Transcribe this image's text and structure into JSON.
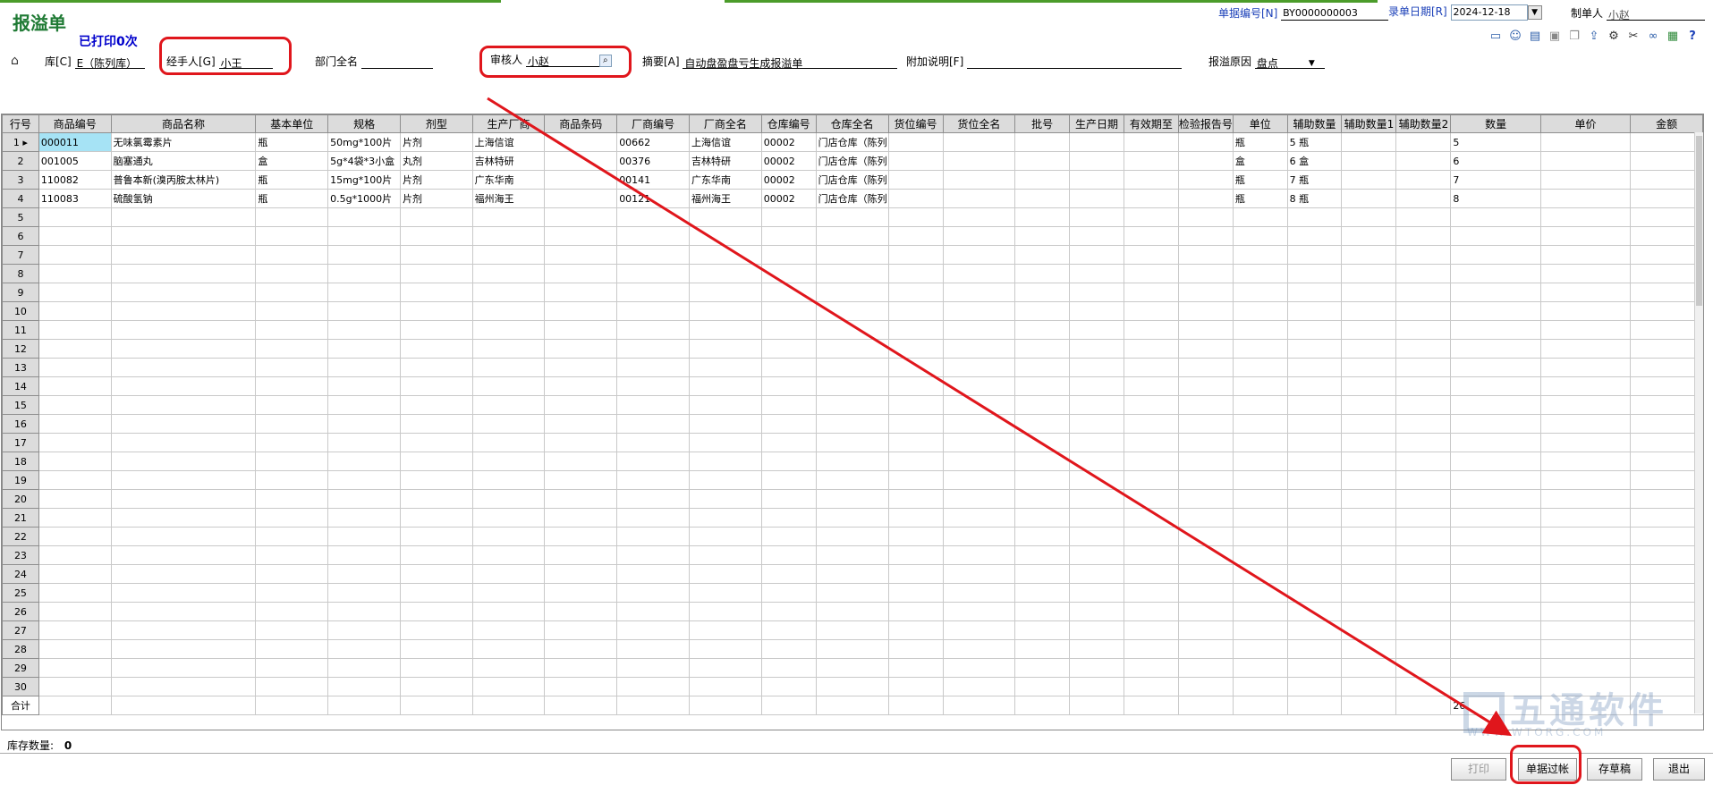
{
  "window": {
    "title": "报溢单",
    "printed_status": "已打印0次"
  },
  "header": {
    "doc_no_label": "单据编号[N]",
    "doc_no_value": "BY0000000003",
    "date_label": "录单日期[R]",
    "date_value": "2024-12-18",
    "maker_label": "制单人",
    "maker_value": "小赵",
    "warehouse_label": "库[C]",
    "warehouse_value": "E（陈列库）",
    "handler_label": "经手人[G]",
    "handler_value": "小王",
    "dept_label": "部门全名",
    "dept_value": "",
    "reviewer_label": "审核人",
    "reviewer_value": "小赵",
    "summary_label": "摘要[A]",
    "summary_value": "自动盘盈盘亏生成报溢单",
    "extra_label": "附加说明[F]",
    "extra_value": "",
    "reason_label": "报溢原因",
    "reason_value": "盘点"
  },
  "toolbar_icons": [
    "page-icon",
    "contact-icon",
    "book-icon",
    "save-icon",
    "copy-icon",
    "export-icon",
    "settings-icon",
    "tools-icon",
    "link-icon",
    "excel-icon",
    "help-icon"
  ],
  "grid": {
    "columns": [
      "行号",
      "商品编号",
      "商品名称",
      "基本单位",
      "规格",
      "剂型",
      "生产厂商",
      "商品条码",
      "厂商编号",
      "厂商全名",
      "仓库编号",
      "仓库全名",
      "货位编号",
      "货位全名",
      "批号",
      "生产日期",
      "有效期至",
      "检验报告号",
      "单位",
      "辅助数量",
      "辅助数量1",
      "辅助数量2",
      "数量",
      "单价",
      "金额"
    ],
    "rows": [
      [
        "1",
        "000011",
        "无味氯霉素片",
        "瓶",
        "50mg*100片",
        "片剂",
        "上海信谊",
        "",
        "00662",
        "上海信谊",
        "00002",
        "门店仓库（陈列",
        "",
        "",
        "",
        "",
        "",
        "",
        "瓶",
        "5 瓶",
        "",
        "",
        "5",
        "",
        ""
      ],
      [
        "2",
        "001005",
        "脑塞通丸",
        "盒",
        "5g*4袋*3小盒",
        "丸剂",
        "吉林特研",
        "",
        "00376",
        "吉林特研",
        "00002",
        "门店仓库（陈列",
        "",
        "",
        "",
        "",
        "",
        "",
        "盒",
        "6 盒",
        "",
        "",
        "6",
        "",
        ""
      ],
      [
        "3",
        "110082",
        "普鲁本新(溴丙胺太林片)",
        "瓶",
        "15mg*100片",
        "片剂",
        "广东华南",
        "",
        "00141",
        "广东华南",
        "00002",
        "门店仓库（陈列",
        "",
        "",
        "",
        "",
        "",
        "",
        "瓶",
        "7 瓶",
        "",
        "",
        "7",
        "",
        ""
      ],
      [
        "4",
        "110083",
        "硫酸氢钠",
        "瓶",
        "0.5g*1000片",
        "片剂",
        "福州海王",
        "",
        "00121",
        "福州海王",
        "00002",
        "门店仓库（陈列",
        "",
        "",
        "",
        "",
        "",
        "",
        "瓶",
        "8 瓶",
        "",
        "",
        "8",
        "",
        ""
      ]
    ],
    "empty_row_numbers": [
      "5",
      "6",
      "7",
      "8",
      "9",
      "10",
      "11",
      "12",
      "13",
      "14",
      "15",
      "16",
      "17",
      "18",
      "19",
      "20",
      "21",
      "22",
      "23",
      "24",
      "25",
      "26",
      "27",
      "28",
      "29",
      "30"
    ],
    "total_label": "合计",
    "total_qty": "26"
  },
  "footer": {
    "stock_label": "库存数量:",
    "stock_value": "0",
    "buttons": {
      "print": "打印",
      "post": "单据过帐",
      "draft": "存草稿",
      "exit": "退出"
    }
  },
  "watermark": {
    "text": "五通软件",
    "url": "WWW.WTORG.COM"
  },
  "colors": {
    "title_green": "#1f7a34",
    "printed_blue": "#0000cc",
    "annotation_red": "#e0161c",
    "header_gray": "#dcdcdc",
    "selected_cell": "#a6e3f5"
  }
}
